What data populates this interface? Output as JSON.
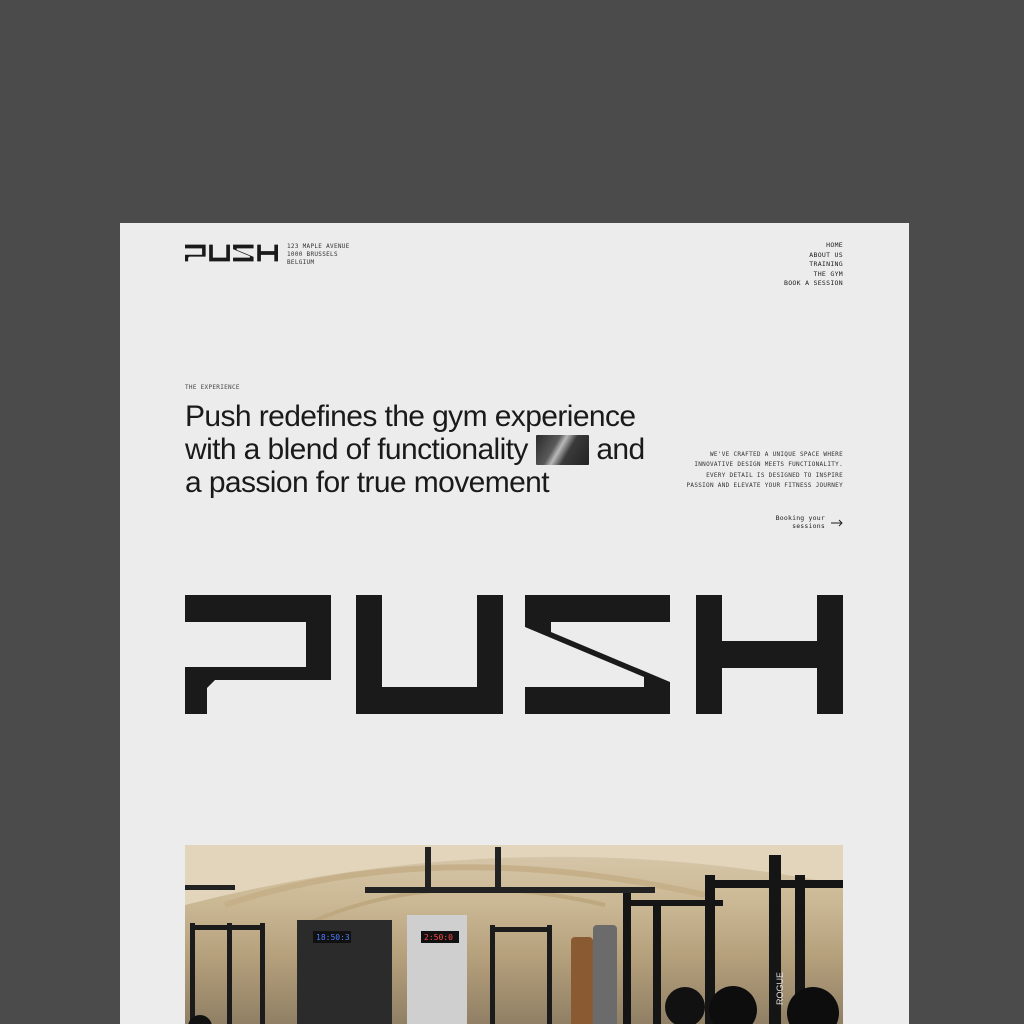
{
  "header": {
    "brand": "PUSH",
    "address": [
      "123 MAPLE AVENUE",
      "1000 BRUSSELS",
      "BELGIUM"
    ],
    "nav": [
      "HOME",
      "ABOUT US",
      "TRAINING",
      "THE GYM",
      "BOOK A SESSION"
    ]
  },
  "intro": {
    "eyebrow": "THE EXPERIENCE",
    "headline_part1": "Push redefines the gym experience with a blend of functionality",
    "headline_part2": "and a passion for true movement",
    "description": "WE'VE CRAFTED A UNIQUE SPACE WHERE INNOVATIVE DESIGN MEETS FUNCTIONALITY. EVERY DETAIL IS DESIGNED TO INSPIRE PASSION AND ELEVATE YOUR FITNESS JOURNEY",
    "booking_label": "Booking your sessions"
  },
  "photo": {
    "timer_left": "18:50:3",
    "timer_right": "2:50:0",
    "rack_brand": "ROGUE"
  },
  "colors": {
    "background": "#4b4b4b",
    "page": "#ececec",
    "ink": "#1a1a1a"
  }
}
